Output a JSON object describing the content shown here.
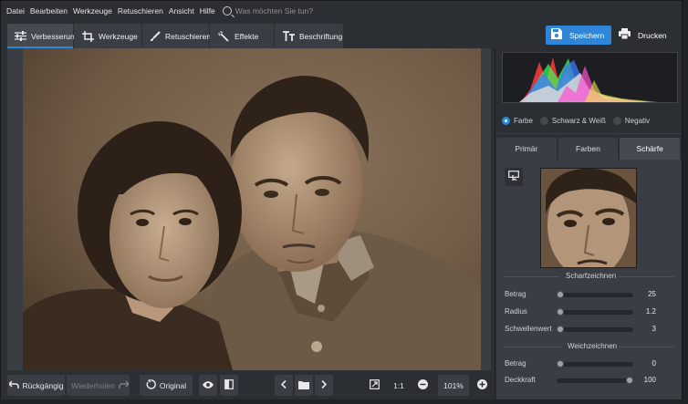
{
  "menu": {
    "items": [
      "Datei",
      "Bearbeiten",
      "Werkzeuge",
      "Retuschieren",
      "Ansicht",
      "Hilfe"
    ],
    "search_placeholder": "Was möchten Sie tun?"
  },
  "toolbar": {
    "tabs": [
      {
        "label": "Verbesserung",
        "icon": "sliders-icon",
        "active": true
      },
      {
        "label": "Werkzeuge",
        "icon": "crop-icon",
        "active": false
      },
      {
        "label": "Retuschieren",
        "icon": "brush-icon",
        "active": false
      },
      {
        "label": "Effekte",
        "icon": "magic-wand-icon",
        "active": false
      },
      {
        "label": "Beschriftung",
        "icon": "text-icon",
        "active": false
      }
    ],
    "save_label": "Speichern",
    "print_label": "Drucken"
  },
  "bottom": {
    "undo_label": "Rückgängig",
    "redo_label": "Wiederholen",
    "original_label": "Original",
    "fit_label": "1:1",
    "zoom": "101%"
  },
  "panel": {
    "color_modes": [
      "Farbe",
      "Schwarz & Weiß",
      "Negativ"
    ],
    "selected_mode": "Farbe",
    "tabs": [
      "Primär",
      "Farben",
      "Schärfe"
    ],
    "active_tab": "Schärfe",
    "sharpen": {
      "title": "Scharfzeichnen",
      "sliders": [
        {
          "label": "Betrag",
          "value": "25",
          "level": 0.0
        },
        {
          "label": "Radius",
          "value": "1.2",
          "level": 0.0
        },
        {
          "label": "Schwellenwert",
          "value": "3",
          "level": 0.0
        }
      ]
    },
    "blur": {
      "title": "Weichzeichnen",
      "sliders": [
        {
          "label": "Betrag",
          "value": "0",
          "level": 0.0
        },
        {
          "label": "Deckkraft",
          "value": "100",
          "level": 1.0
        }
      ]
    }
  },
  "colors": {
    "accent": "#2f86d6",
    "panel_bg": "#2b2e33",
    "tab_bg": "#3a3e44"
  }
}
